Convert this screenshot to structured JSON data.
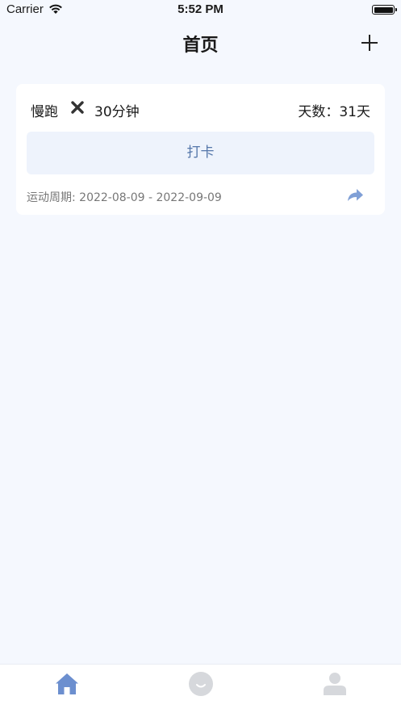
{
  "status_bar": {
    "carrier": "Carrier",
    "time": "5:52 PM"
  },
  "nav": {
    "title": "首页"
  },
  "card": {
    "exercise": "慢跑",
    "duration": "30分钟",
    "days": "天数：31天",
    "checkin_label": "打卡",
    "period": "运动周期: 2022-08-09 - 2022-09-09"
  },
  "colors": {
    "background": "#f5f8fe",
    "accent": "#5577aa",
    "tab_active": "#6c8fcf",
    "tab_inactive": "#d6d8dc"
  },
  "tabs": [
    {
      "icon": "home-icon",
      "active": true
    },
    {
      "icon": "smile-icon",
      "active": false
    },
    {
      "icon": "user-icon",
      "active": false
    }
  ]
}
